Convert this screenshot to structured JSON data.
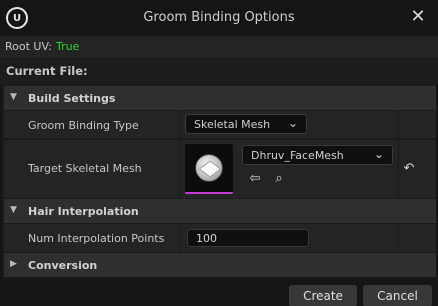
{
  "window": {
    "title": "Groom Binding Options",
    "logo_glyph": "U",
    "close_glyph": "✕"
  },
  "root_uv": {
    "label": "Root UV:",
    "value": "True",
    "value_color": "#2fd32f"
  },
  "current_file": {
    "label": "Current File:"
  },
  "sections": {
    "build_settings": {
      "label": "Build Settings",
      "arrow": "▼",
      "groom_binding_type": {
        "label": "Groom Binding Type",
        "value": "Skeletal Mesh",
        "chevron": "⌄"
      },
      "target_skeletal_mesh": {
        "label": "Target Skeletal Mesh",
        "asset": "Dhruv_FaceMesh",
        "chevron": "⌄",
        "use_selected_glyph": "⇦",
        "browse_glyph": "⌕",
        "reset_glyph": "↶",
        "accent": "#c23bd4"
      }
    },
    "hair_interpolation": {
      "label": "Hair Interpolation",
      "arrow": "▼",
      "num_points": {
        "label": "Num Interpolation Points",
        "value": "100"
      }
    },
    "conversion": {
      "label": "Conversion",
      "arrow": "▶"
    }
  },
  "footer": {
    "create_label": "Create",
    "cancel_label": "Cancel"
  }
}
